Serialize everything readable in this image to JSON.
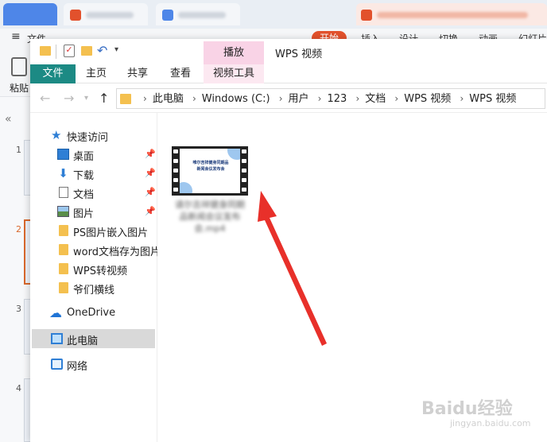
{
  "wps": {
    "menu": [
      "文件",
      "开始",
      "插入",
      "设计",
      "切换",
      "动画",
      "幻灯片"
    ],
    "paste_label": "粘贴",
    "collapse_glyph": "«",
    "slide_numbers": [
      "1",
      "2",
      "3",
      "4"
    ]
  },
  "explorer": {
    "title": "WPS 视频",
    "contextual_tab": "播放",
    "ribbon_tabs": [
      "文件",
      "主页",
      "共享",
      "查看",
      "视频工具"
    ],
    "address_crumbs": [
      "此电脑",
      "Windows (C:)",
      "用户",
      "123",
      "文档",
      "WPS 视频",
      "WPS 视频"
    ],
    "nav": {
      "quick_access": "快速访问",
      "items": [
        {
          "label": "桌面",
          "icon": "desktop-icon",
          "pinned": true
        },
        {
          "label": "下载",
          "icon": "download-icon",
          "pinned": true
        },
        {
          "label": "文档",
          "icon": "document-icon",
          "pinned": true
        },
        {
          "label": "图片",
          "icon": "picture-icon",
          "pinned": true
        },
        {
          "label": "PS图片嵌入图片",
          "icon": "folder-icon",
          "pinned": false
        },
        {
          "label": "word文档存为图片",
          "icon": "folder-icon",
          "pinned": false
        },
        {
          "label": "WPS转视频",
          "icon": "folder-icon",
          "pinned": false
        },
        {
          "label": "爷们横线",
          "icon": "folder-icon",
          "pinned": false
        }
      ],
      "onedrive": "OneDrive",
      "this_pc": "此电脑",
      "network": "网络"
    },
    "file": {
      "thumbnail_title": "唯尔吉祥健身同期品 新闻会议发布会",
      "name_lines": [
        "请尔吉祥健身同期",
        "品新闻会议发布",
        "会.mp4"
      ]
    }
  },
  "watermark": {
    "main": "Baidu经验",
    "sub": "jingyan.baidu.com"
  }
}
